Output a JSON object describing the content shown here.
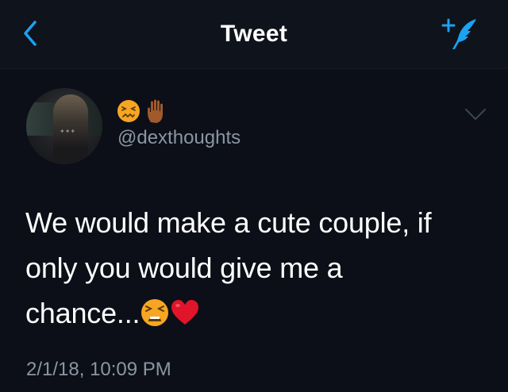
{
  "nav": {
    "title": "Tweet",
    "back_icon": "chevron-left-icon",
    "compose_icon": "compose-tweet-icon",
    "accent_color": "#1da1f2"
  },
  "tweet": {
    "name_emojis": [
      "confounded-face-emoji",
      "raised-hand-emoji"
    ],
    "handle": "@dexthoughts",
    "text_line1": "We would make a cute couple, if",
    "text_line2": "only you would give me a",
    "text_line3": "chance...",
    "text_emojis": [
      "tired-face-emoji",
      "red-heart-emoji"
    ],
    "timestamp": "2/1/18, 10:09 PM",
    "menu_icon": "chevron-down-icon"
  },
  "colors": {
    "background": "#0c0f17",
    "secondary_text": "#8a96a3",
    "primary_text": "#ffffff"
  }
}
